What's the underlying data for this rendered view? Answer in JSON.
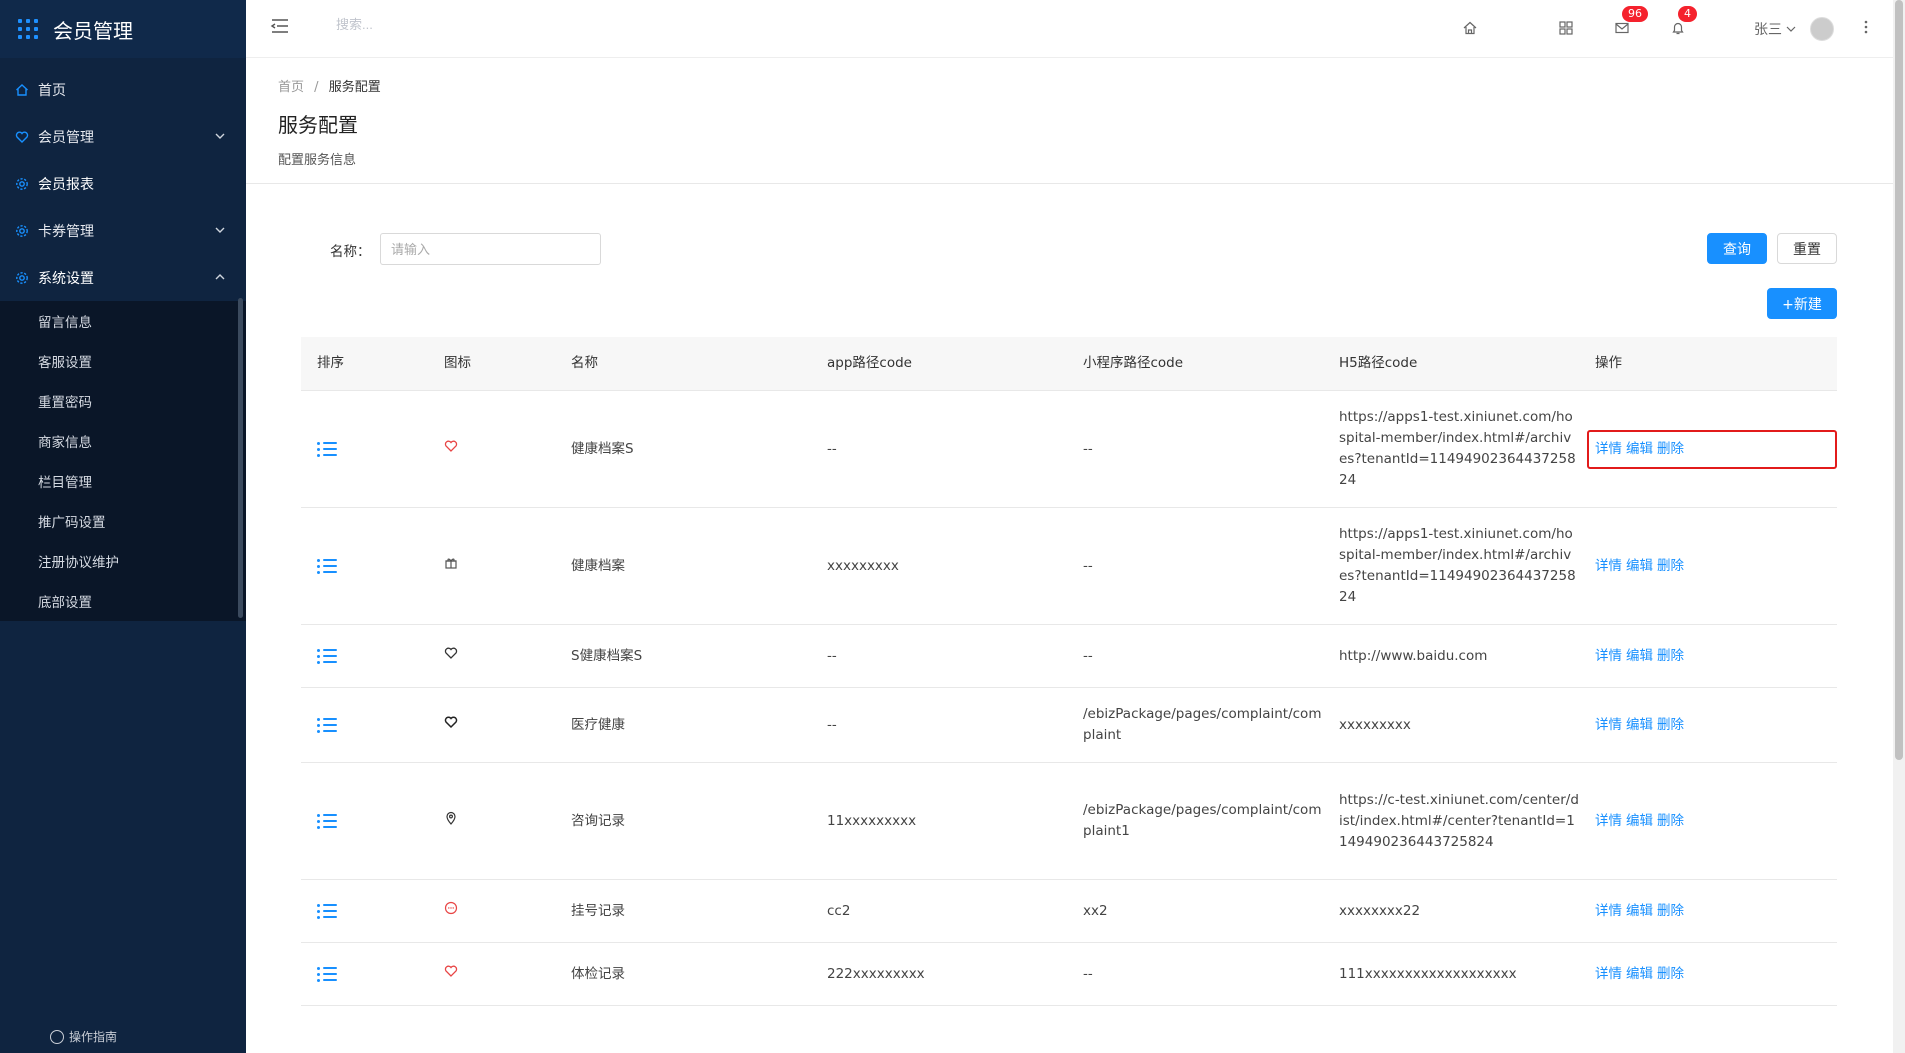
{
  "app": {
    "title": "会员管理"
  },
  "sidebar": {
    "items": [
      {
        "label": "首页",
        "icon": "home-icon"
      },
      {
        "label": "会员管理",
        "icon": "heart-shield-icon"
      },
      {
        "label": "会员报表",
        "icon": "gear-icon"
      },
      {
        "label": "卡券管理",
        "icon": "gear-icon"
      },
      {
        "label": "系统设置",
        "icon": "gear-icon"
      }
    ],
    "sub_items": [
      "留言信息",
      "客服设置",
      "重置密码",
      "商家信息",
      "栏目管理",
      "推广码设置",
      "注册协议维护",
      "底部设置"
    ],
    "guide": "操作指南"
  },
  "header": {
    "search_placeholder": "搜索...",
    "mail_badge": "96",
    "bell_badge": "4",
    "user_name": "张三"
  },
  "page": {
    "breadcrumb_home": "首页",
    "breadcrumb_sep": "/",
    "breadcrumb_current": "服务配置",
    "title": "服务配置",
    "description": "配置服务信息"
  },
  "filter": {
    "name_label": "名称：",
    "name_placeholder": "请输入",
    "query_label": "查询",
    "reset_label": "重置",
    "new_label": "+新建"
  },
  "table": {
    "headers": [
      "排序",
      "图标",
      "名称",
      "app路径code",
      "小程序路径code",
      "H5路径code",
      "操作"
    ],
    "ops": {
      "detail": "详情",
      "edit": "编辑",
      "delete": "删除"
    },
    "rows": [
      {
        "icon": "heart-icon",
        "icon_color": "#e84545",
        "name": "健康档案S",
        "app": "--",
        "mini": "--",
        "h5": "https://apps1-test.xiniunet.com/hospital-member/index.html#/archives?tenantId=1149490236443725824"
      },
      {
        "icon": "gift-icon",
        "icon_color": "#555555",
        "name": "健康档案",
        "app": "xxxxxxxxx",
        "mini": "--",
        "h5": "https://apps1-test.xiniunet.com/hospital-member/index.html#/archives?tenantId=1149490236443725824"
      },
      {
        "icon": "heart-outline-icon",
        "icon_color": "#333333",
        "name": "S健康档案S",
        "app": "--",
        "mini": "--",
        "h5": "http://www.baidu.com"
      },
      {
        "icon": "heart-outline-icon",
        "icon_color": "#222222",
        "name": "医疗健康",
        "app": "--",
        "mini": "/ebizPackage/pages/complaint/complaint",
        "h5": "xxxxxxxxx"
      },
      {
        "icon": "location-pin-icon",
        "icon_color": "#333333",
        "name": "咨询记录",
        "app": "11xxxxxxxxx",
        "mini": "/ebizPackage/pages/complaint/complaint1",
        "h5": "https://c-test.xiniunet.com/center/dist/index.html#/center?tenantId=1149490236443725824"
      },
      {
        "icon": "chat-bubble-icon",
        "icon_color": "#e84545",
        "name": "挂号记录",
        "app": "cc2",
        "mini": "xx2",
        "h5": "xxxxxxxx22"
      },
      {
        "icon": "heart-icon",
        "icon_color": "#e84545",
        "name": "体检记录",
        "app": "222xxxxxxxxx",
        "mini": "--",
        "h5": "111xxxxxxxxxxxxxxxxxxx"
      }
    ]
  }
}
